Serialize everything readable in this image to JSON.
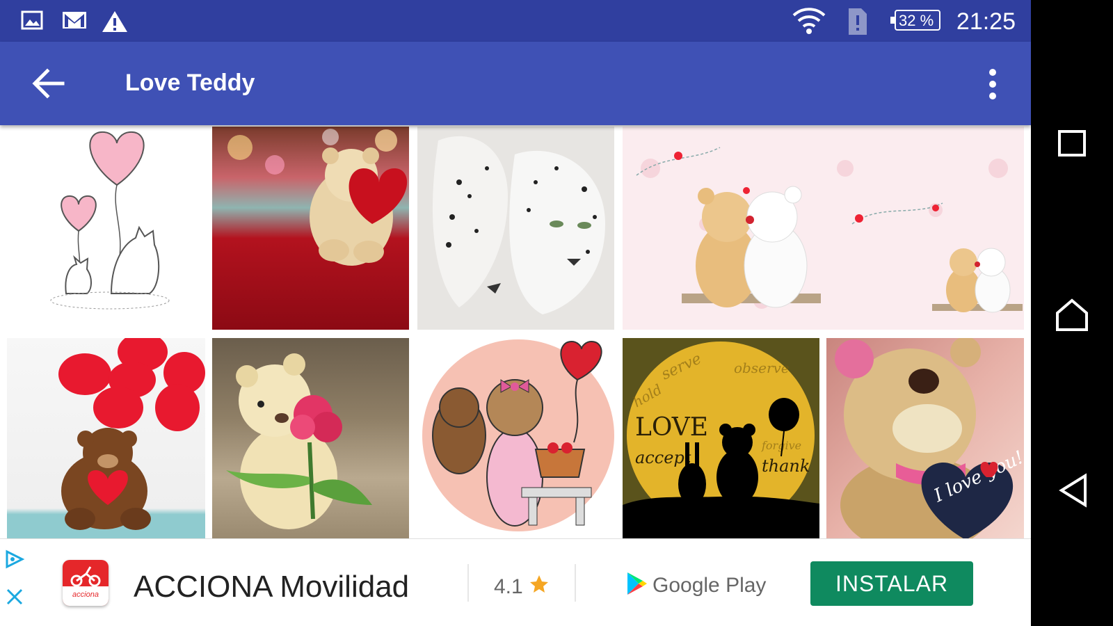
{
  "status_bar": {
    "battery_text": "32 %",
    "time": "21:25",
    "icons": [
      "image-icon",
      "gmail-icon",
      "warning-icon",
      "wifi-icon",
      "sim-alert-icon",
      "battery-icon"
    ]
  },
  "toolbar": {
    "title": "Love Teddy",
    "back_icon": "arrow-left-icon",
    "menu_icon": "more-vert-icon"
  },
  "grid": {
    "tiles": [
      {
        "subject": "balloon hearts drawing"
      },
      {
        "subject": "teddy bear with red heart"
      },
      {
        "subject": "snow leopards"
      },
      {
        "subject": "two bears kissing"
      },
      {
        "subject": "red balloons teddy"
      },
      {
        "subject": "teddy with rose"
      },
      {
        "subject": "bears with heart balloon"
      },
      {
        "subject": "love words silhouette"
      },
      {
        "subject": "teddy with i love you heart"
      }
    ],
    "tile_texts": {
      "love": "LOVE",
      "accept": "accept",
      "thank": "thank",
      "heart_msg": "I love you!"
    }
  },
  "ad": {
    "app_name": "ACCIONA Movilidad",
    "rating": "4.1",
    "store_label": "Google Play",
    "install_label": "INSTALAR",
    "icon_label": "acciona"
  },
  "colors": {
    "status_bar": "#303f9f",
    "toolbar": "#3f51b5",
    "install": "#0f8a5f",
    "star": "#f5a623"
  }
}
